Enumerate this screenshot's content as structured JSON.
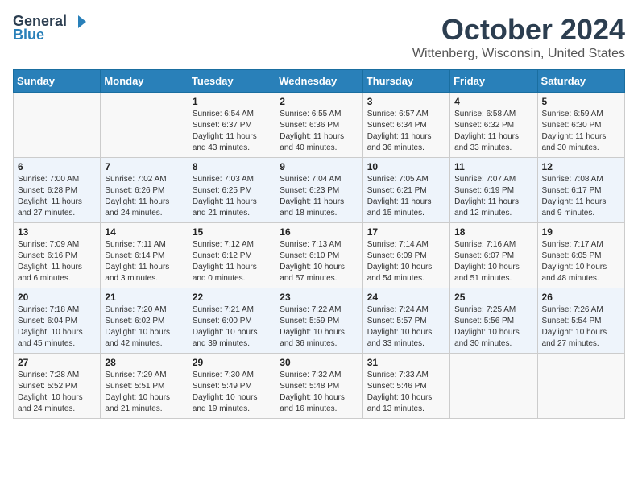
{
  "logo": {
    "general": "General",
    "blue": "Blue"
  },
  "title": "October 2024",
  "location": "Wittenberg, Wisconsin, United States",
  "days_header": [
    "Sunday",
    "Monday",
    "Tuesday",
    "Wednesday",
    "Thursday",
    "Friday",
    "Saturday"
  ],
  "weeks": [
    [
      {
        "day": "",
        "info": ""
      },
      {
        "day": "",
        "info": ""
      },
      {
        "day": "1",
        "info": "Sunrise: 6:54 AM\nSunset: 6:37 PM\nDaylight: 11 hours and 43 minutes."
      },
      {
        "day": "2",
        "info": "Sunrise: 6:55 AM\nSunset: 6:36 PM\nDaylight: 11 hours and 40 minutes."
      },
      {
        "day": "3",
        "info": "Sunrise: 6:57 AM\nSunset: 6:34 PM\nDaylight: 11 hours and 36 minutes."
      },
      {
        "day": "4",
        "info": "Sunrise: 6:58 AM\nSunset: 6:32 PM\nDaylight: 11 hours and 33 minutes."
      },
      {
        "day": "5",
        "info": "Sunrise: 6:59 AM\nSunset: 6:30 PM\nDaylight: 11 hours and 30 minutes."
      }
    ],
    [
      {
        "day": "6",
        "info": "Sunrise: 7:00 AM\nSunset: 6:28 PM\nDaylight: 11 hours and 27 minutes."
      },
      {
        "day": "7",
        "info": "Sunrise: 7:02 AM\nSunset: 6:26 PM\nDaylight: 11 hours and 24 minutes."
      },
      {
        "day": "8",
        "info": "Sunrise: 7:03 AM\nSunset: 6:25 PM\nDaylight: 11 hours and 21 minutes."
      },
      {
        "day": "9",
        "info": "Sunrise: 7:04 AM\nSunset: 6:23 PM\nDaylight: 11 hours and 18 minutes."
      },
      {
        "day": "10",
        "info": "Sunrise: 7:05 AM\nSunset: 6:21 PM\nDaylight: 11 hours and 15 minutes."
      },
      {
        "day": "11",
        "info": "Sunrise: 7:07 AM\nSunset: 6:19 PM\nDaylight: 11 hours and 12 minutes."
      },
      {
        "day": "12",
        "info": "Sunrise: 7:08 AM\nSunset: 6:17 PM\nDaylight: 11 hours and 9 minutes."
      }
    ],
    [
      {
        "day": "13",
        "info": "Sunrise: 7:09 AM\nSunset: 6:16 PM\nDaylight: 11 hours and 6 minutes."
      },
      {
        "day": "14",
        "info": "Sunrise: 7:11 AM\nSunset: 6:14 PM\nDaylight: 11 hours and 3 minutes."
      },
      {
        "day": "15",
        "info": "Sunrise: 7:12 AM\nSunset: 6:12 PM\nDaylight: 11 hours and 0 minutes."
      },
      {
        "day": "16",
        "info": "Sunrise: 7:13 AM\nSunset: 6:10 PM\nDaylight: 10 hours and 57 minutes."
      },
      {
        "day": "17",
        "info": "Sunrise: 7:14 AM\nSunset: 6:09 PM\nDaylight: 10 hours and 54 minutes."
      },
      {
        "day": "18",
        "info": "Sunrise: 7:16 AM\nSunset: 6:07 PM\nDaylight: 10 hours and 51 minutes."
      },
      {
        "day": "19",
        "info": "Sunrise: 7:17 AM\nSunset: 6:05 PM\nDaylight: 10 hours and 48 minutes."
      }
    ],
    [
      {
        "day": "20",
        "info": "Sunrise: 7:18 AM\nSunset: 6:04 PM\nDaylight: 10 hours and 45 minutes."
      },
      {
        "day": "21",
        "info": "Sunrise: 7:20 AM\nSunset: 6:02 PM\nDaylight: 10 hours and 42 minutes."
      },
      {
        "day": "22",
        "info": "Sunrise: 7:21 AM\nSunset: 6:00 PM\nDaylight: 10 hours and 39 minutes."
      },
      {
        "day": "23",
        "info": "Sunrise: 7:22 AM\nSunset: 5:59 PM\nDaylight: 10 hours and 36 minutes."
      },
      {
        "day": "24",
        "info": "Sunrise: 7:24 AM\nSunset: 5:57 PM\nDaylight: 10 hours and 33 minutes."
      },
      {
        "day": "25",
        "info": "Sunrise: 7:25 AM\nSunset: 5:56 PM\nDaylight: 10 hours and 30 minutes."
      },
      {
        "day": "26",
        "info": "Sunrise: 7:26 AM\nSunset: 5:54 PM\nDaylight: 10 hours and 27 minutes."
      }
    ],
    [
      {
        "day": "27",
        "info": "Sunrise: 7:28 AM\nSunset: 5:52 PM\nDaylight: 10 hours and 24 minutes."
      },
      {
        "day": "28",
        "info": "Sunrise: 7:29 AM\nSunset: 5:51 PM\nDaylight: 10 hours and 21 minutes."
      },
      {
        "day": "29",
        "info": "Sunrise: 7:30 AM\nSunset: 5:49 PM\nDaylight: 10 hours and 19 minutes."
      },
      {
        "day": "30",
        "info": "Sunrise: 7:32 AM\nSunset: 5:48 PM\nDaylight: 10 hours and 16 minutes."
      },
      {
        "day": "31",
        "info": "Sunrise: 7:33 AM\nSunset: 5:46 PM\nDaylight: 10 hours and 13 minutes."
      },
      {
        "day": "",
        "info": ""
      },
      {
        "day": "",
        "info": ""
      }
    ]
  ]
}
